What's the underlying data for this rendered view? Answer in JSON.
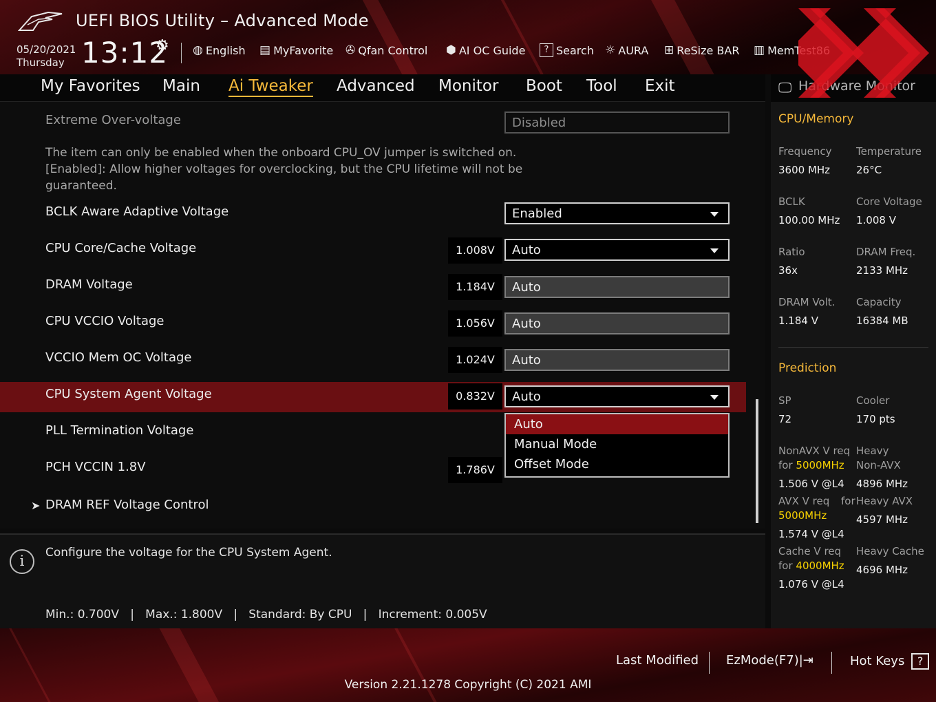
{
  "header": {
    "title": "UEFI BIOS Utility – Advanced Mode",
    "date": "05/20/2021",
    "day": "Thursday",
    "time": "13:12",
    "tools": [
      {
        "label": "English",
        "icon": "globe-icon"
      },
      {
        "label": "MyFavorite",
        "icon": "favorite-icon"
      },
      {
        "label": "Qfan Control",
        "icon": "fan-icon"
      },
      {
        "label": "AI OC Guide",
        "icon": "ai-oc-icon"
      },
      {
        "label": "Search",
        "icon": "search-icon"
      },
      {
        "label": "AURA",
        "icon": "aura-icon"
      },
      {
        "label": "ReSize BAR",
        "icon": "resize-bar-icon"
      },
      {
        "label": "MemTest86",
        "icon": "memtest-icon"
      }
    ]
  },
  "tabs": [
    "My Favorites",
    "Main",
    "Ai Tweaker",
    "Advanced",
    "Monitor",
    "Boot",
    "Tool",
    "Exit"
  ],
  "active_tab": "Ai Tweaker",
  "settings": {
    "extreme_ov": {
      "label": "Extreme Over-voltage",
      "value": "Disabled"
    },
    "description": "The item can only be enabled when the onboard CPU_OV jumper is switched on. [Enabled]: Allow higher voltages for overclocking, but the CPU lifetime will not be guaranteed.",
    "bclk_aware": {
      "label": "BCLK Aware Adaptive Voltage",
      "value": "Enabled"
    },
    "cpu_core": {
      "label": "CPU Core/Cache Voltage",
      "reading": "1.008V",
      "value": "Auto"
    },
    "dram": {
      "label": "DRAM Voltage",
      "reading": "1.184V",
      "value": "Auto"
    },
    "vccio": {
      "label": "CPU VCCIO Voltage",
      "reading": "1.056V",
      "value": "Auto"
    },
    "vccio_mem": {
      "label": "VCCIO Mem OC Voltage",
      "reading": "1.024V",
      "value": "Auto"
    },
    "system_agent": {
      "label": "CPU System Agent Voltage",
      "reading": "0.832V",
      "value": "Auto"
    },
    "pll_term": {
      "label": "PLL Termination Voltage"
    },
    "pch_vccin": {
      "label": "PCH VCCIN 1.8V",
      "reading": "1.786V"
    },
    "dram_ref": {
      "label": "DRAM REF Voltage Control"
    }
  },
  "dropdown": {
    "options": [
      "Auto",
      "Manual Mode",
      "Offset Mode"
    ],
    "highlighted": "Auto"
  },
  "help": {
    "text": "Configure the voltage for the CPU System Agent.",
    "range": "Min.: 0.700V   |   Max.: 1.800V   |   Standard: By CPU   |   Increment: 0.005V"
  },
  "hw_monitor": {
    "title": "Hardware Monitor",
    "cpu_memory": {
      "title": "CPU/Memory",
      "frequency_label": "Frequency",
      "frequency": "3600 MHz",
      "temperature_label": "Temperature",
      "temperature": "26°C",
      "bclk_label": "BCLK",
      "bclk": "100.00 MHz",
      "core_voltage_label": "Core Voltage",
      "core_voltage": "1.008 V",
      "ratio_label": "Ratio",
      "ratio": "36x",
      "dram_freq_label": "DRAM Freq.",
      "dram_freq": "2133 MHz",
      "dram_volt_label": "DRAM Volt.",
      "dram_volt": "1.184 V",
      "capacity_label": "Capacity",
      "capacity": "16384 MB"
    },
    "prediction": {
      "title": "Prediction",
      "sp_label": "SP",
      "sp": "72",
      "cooler_label": "Cooler",
      "cooler": "170 pts",
      "nonavx_req_label": "NonAVX V req",
      "for_label": "for",
      "nonavx_freq": "5000MHz",
      "nonavx_v": "1.506 V @L4",
      "heavy_label": "Heavy",
      "nonavx_label": "Non-AVX",
      "heavy_nonavx": "4896 MHz",
      "avx_req_label": "AVX V req",
      "avx_for_label": "for",
      "avx_freq": "5000MHz",
      "avx_v": "1.574 V @L4",
      "heavy_avx_label": "Heavy AVX",
      "heavy_avx": "4597 MHz",
      "cache_req_label": "Cache V req",
      "cache_for_label": "for",
      "cache_freq": "4000MHz",
      "cache_v": "1.076 V @L4",
      "heavy_cache_label": "Heavy Cache",
      "heavy_cache": "4696 MHz"
    }
  },
  "footer": {
    "last_modified": "Last Modified",
    "ezmode": "EzMode(F7)|",
    "hotkeys": "Hot Keys",
    "hotkeys_icon": "?",
    "version": "Version 2.21.1278 Copyright (C) 2021 AMI"
  },
  "colors": {
    "accent": "#f5b83a",
    "selection": "#6a0f12",
    "highlight_value": "#f5d000"
  }
}
